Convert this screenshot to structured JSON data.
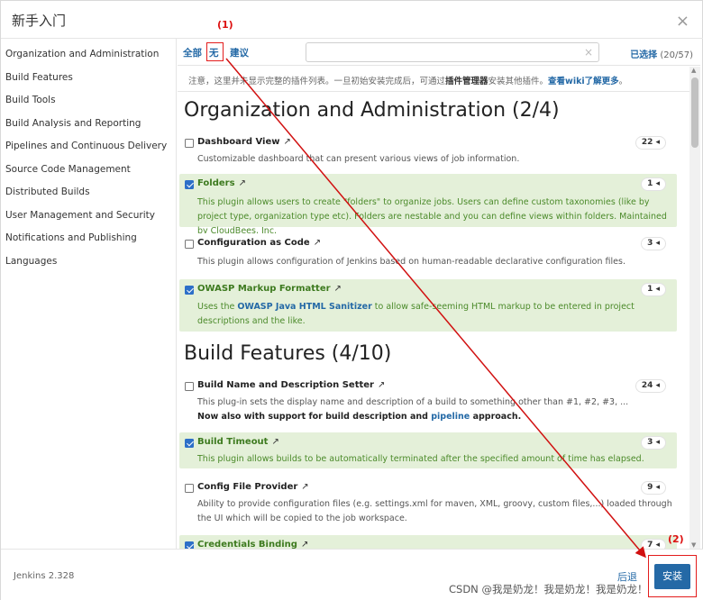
{
  "dialog": {
    "title": "新手入门",
    "close_icon": "×"
  },
  "sidebar": {
    "items": [
      "Organization and Administration",
      "Build Features",
      "Build Tools",
      "Build Analysis and Reporting",
      "Pipelines and Continuous Delivery",
      "Source Code Management",
      "Distributed Builds",
      "User Management and Security",
      "Notifications and Publishing",
      "Languages"
    ]
  },
  "toolbar": {
    "all": "全部",
    "none": "无",
    "suggested": "建议",
    "search_placeholder": "",
    "clear_icon": "×",
    "selected_label": "已选择",
    "selected_count": "(20/57)"
  },
  "notice": {
    "part1": "注意，这里并未显示完整的插件列表。一旦初始安装完成后，可通过",
    "bold": "插件管理器",
    "part2": "安装其他插件。",
    "link": "查看wiki了解更多",
    "end": "。"
  },
  "sections": [
    {
      "title": "Organization and Administration (2/4)"
    },
    {
      "title": "Build Features (4/10)"
    }
  ],
  "plugins": [
    {
      "name": "Dashboard View",
      "badge": "22 ◂",
      "selected": false,
      "desc": "Customizable dashboard that can present various views of job information."
    },
    {
      "name": "Folders",
      "badge": "1 ◂",
      "selected": true,
      "desc": "This plugin allows users to create \"folders\" to organize jobs. Users can define custom taxonomies (like by project type, organization type etc). Folders are nestable and you can define views within folders. Maintained by CloudBees, Inc."
    },
    {
      "name": "Configuration as Code",
      "badge": "3 ◂",
      "selected": false,
      "desc": "This plugin allows configuration of Jenkins based on human-readable declarative configuration files."
    },
    {
      "name": "OWASP Markup Formatter",
      "badge": "1 ◂",
      "selected": true,
      "desc_pre": "Uses the ",
      "desc_link": "OWASP Java HTML Sanitizer",
      "desc_post": " to allow safe-seeming HTML markup to be entered in project descriptions and the like."
    },
    {
      "name": "Build Name and Description Setter",
      "badge": "24 ◂",
      "selected": false,
      "desc": "This plug-in sets the display name and description of a build to something other than #1, #2, #3, ...",
      "desc2_pre": "Now also with support for build description and ",
      "desc2_link": "pipeline",
      "desc2_post": " approach."
    },
    {
      "name": "Build Timeout",
      "badge": "3 ◂",
      "selected": true,
      "desc": "This plugin allows builds to be automatically terminated after the specified amount of time has elapsed."
    },
    {
      "name": "Config File Provider",
      "badge": "9 ◂",
      "selected": false,
      "desc": "Ability to provide configuration files (e.g. settings.xml for maven, XML, groovy, custom files,...) loaded through the UI which will be copied to the job workspace."
    },
    {
      "name": "Credentials Binding",
      "badge": "7 ◂",
      "selected": true,
      "desc": ""
    }
  ],
  "link_icon": "↗",
  "footer": {
    "version": "Jenkins 2.328",
    "back": "后退",
    "install": "安装",
    "watermark": "CSDN @我是奶龙！我是奶龙！我是奶龙！"
  },
  "annotations": {
    "step1": "(1)",
    "step2": "(2)",
    "color": "#d11111"
  }
}
